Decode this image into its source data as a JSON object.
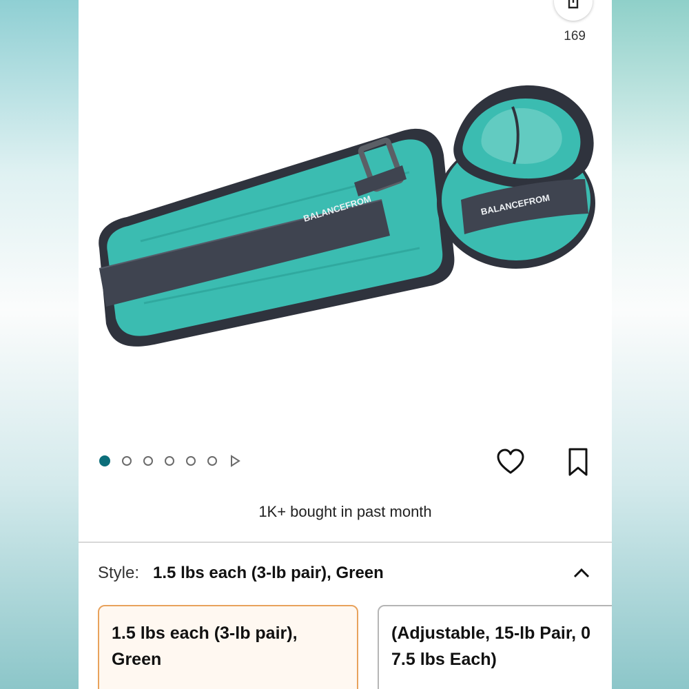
{
  "share": {
    "count": "169"
  },
  "product": {
    "brand_on_strap": "BALANCEFROM",
    "image_count": 6
  },
  "actions": {
    "bought": "1K+ bought in past month"
  },
  "style": {
    "label": "Style:",
    "selected": "1.5 lbs each (3-lb pair), Green"
  },
  "options": [
    {
      "line1": "1.5 lbs each (3-lb pair),",
      "line2": "Green"
    },
    {
      "line1": "(Adjustable, 15-lb Pair, 0",
      "line2": "7.5 lbs Each)"
    }
  ],
  "colors": {
    "accent_dot": "#0c6e7a",
    "selected_border": "#e8a25c",
    "weight_teal": "#36b7ad",
    "strap_gray": "#3f4450"
  }
}
